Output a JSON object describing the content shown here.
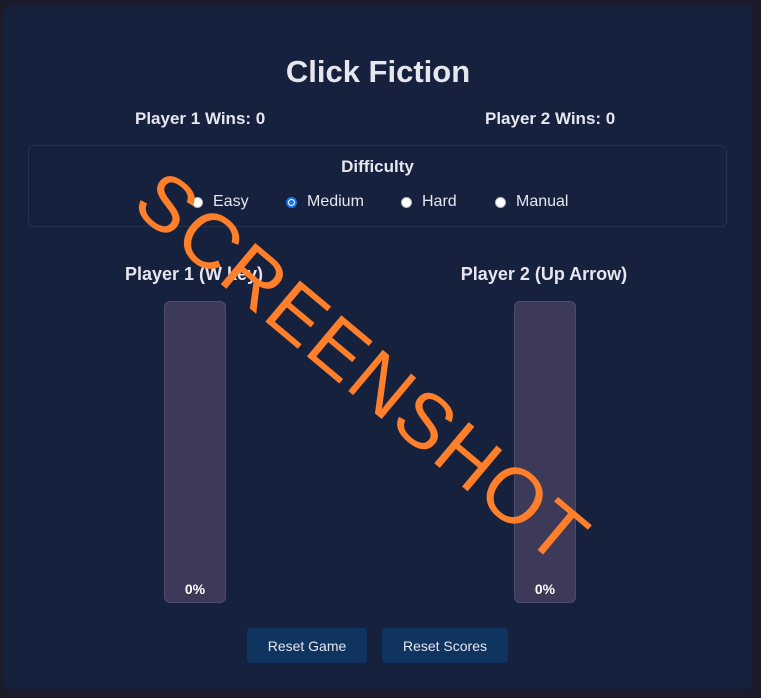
{
  "app": {
    "title": "Click Fiction"
  },
  "scores": {
    "player1": "Player 1 Wins: 0",
    "player2": "Player 2 Wins: 0"
  },
  "difficulty": {
    "heading": "Difficulty",
    "options": [
      "Easy",
      "Medium",
      "Hard",
      "Manual"
    ],
    "selected": "Medium"
  },
  "players": [
    {
      "label": "Player 1 (W key)",
      "progress_percent": 0,
      "progress_text": "0%"
    },
    {
      "label": "Player 2 (Up Arrow)",
      "progress_percent": 0,
      "progress_text": "0%"
    }
  ],
  "buttons": {
    "reset_game": "Reset Game",
    "reset_scores": "Reset Scores"
  },
  "watermark": "SCREENSHOT",
  "colors": {
    "background": "#16213e",
    "button": "#0f3460",
    "radio_accent": "#1a73e8",
    "meter": "#3c3959",
    "watermark": "#ff7f2a"
  }
}
